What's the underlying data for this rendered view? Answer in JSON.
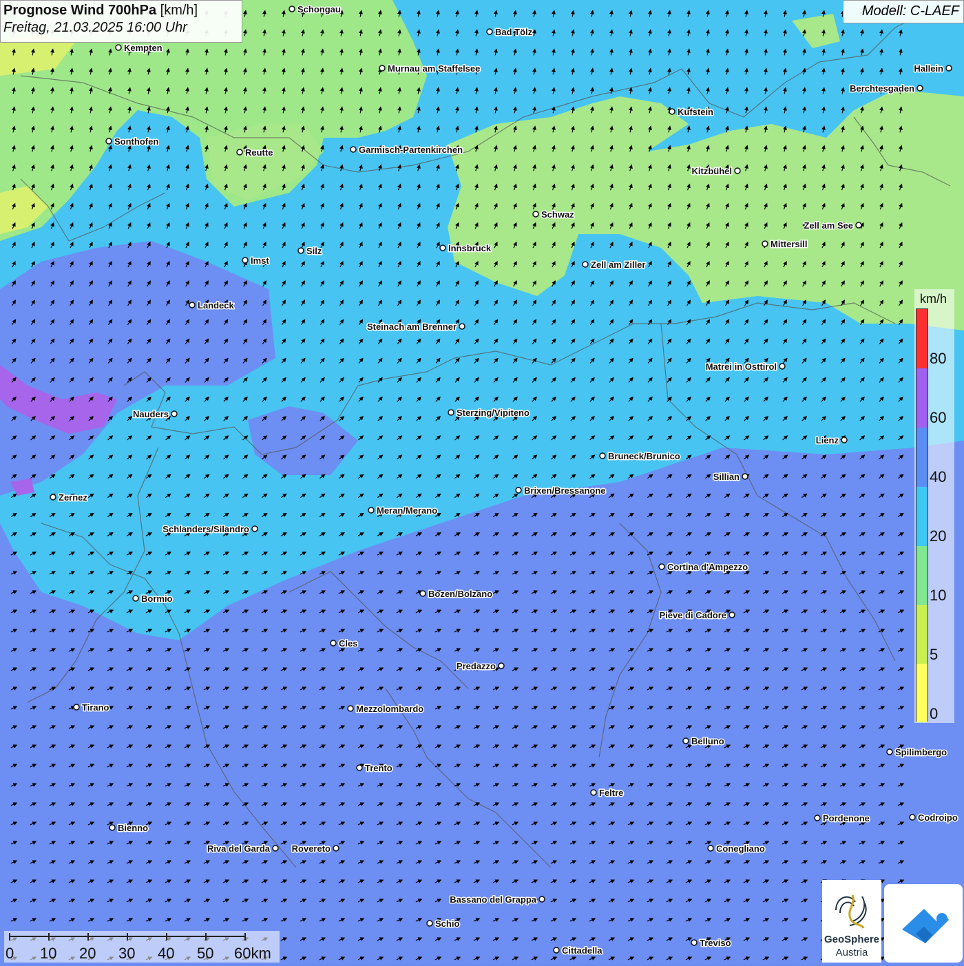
{
  "header": {
    "title_bold": "Prognose Wind 700hPa",
    "title_unit": " [km/h]",
    "subtitle": "Freitag, 21.03.2025 16:00 Uhr"
  },
  "model": "Modell: C-LAEF",
  "legend": {
    "unit": "km/h",
    "items": [
      {
        "value": "80",
        "color": "#ff3030"
      },
      {
        "value": "60",
        "color": "#a060f0"
      },
      {
        "value": "40",
        "color": "#5a8ef5"
      },
      {
        "value": "20",
        "color": "#40c8f5"
      },
      {
        "value": "10",
        "color": "#80e890"
      },
      {
        "value": "5",
        "color": "#c8f050"
      },
      {
        "value": "0",
        "color": "#ffff60"
      }
    ]
  },
  "scale": {
    "ticks": [
      "0",
      "10",
      "20",
      "30",
      "40",
      "50",
      "60km"
    ]
  },
  "cities": [
    {
      "name": "Schongau",
      "label_side": "right"
    },
    {
      "name": "Bad Tölz",
      "label_side": "right"
    },
    {
      "name": "Kempten",
      "label_side": "right"
    },
    {
      "name": "Murnau am Staffelsee",
      "label_side": "right"
    },
    {
      "name": "Hallein",
      "label_side": "left"
    },
    {
      "name": "Berchtesgaden",
      "label_side": "left"
    },
    {
      "name": "Kufstein",
      "label_side": "right"
    },
    {
      "name": "Sonthofen",
      "label_side": "right"
    },
    {
      "name": "Reutte",
      "label_side": "right"
    },
    {
      "name": "Garmisch-Partenkirchen",
      "label_side": "right"
    },
    {
      "name": "Kitzbühel",
      "label_side": "left"
    },
    {
      "name": "Schwaz",
      "label_side": "right"
    },
    {
      "name": "Zell am See",
      "label_side": "left"
    },
    {
      "name": "Mittersill",
      "label_side": "right"
    },
    {
      "name": "Innsbruck",
      "label_side": "right"
    },
    {
      "name": "Silz",
      "label_side": "right"
    },
    {
      "name": "Imst",
      "label_side": "right"
    },
    {
      "name": "Zell am Ziller",
      "label_side": "right"
    },
    {
      "name": "Landeck",
      "label_side": "right"
    },
    {
      "name": "Steinach am Brenner",
      "label_side": "left"
    },
    {
      "name": "Matrei in Osttirol",
      "label_side": "left"
    },
    {
      "name": "Nauders",
      "label_side": "left"
    },
    {
      "name": "Sterzing/Vipiteno",
      "label_side": "right"
    },
    {
      "name": "Lienz",
      "label_side": "left"
    },
    {
      "name": "Bruneck/Brunico",
      "label_side": "right"
    },
    {
      "name": "Sillian",
      "label_side": "left"
    },
    {
      "name": "Zernez",
      "label_side": "right"
    },
    {
      "name": "Brixen/Bressanone",
      "label_side": "right"
    },
    {
      "name": "Meran/Merano",
      "label_side": "right"
    },
    {
      "name": "Schlanders/Silandro",
      "label_side": "left"
    },
    {
      "name": "Cortina d'Ampezzo",
      "label_side": "right"
    },
    {
      "name": "Bozen/Bolzano",
      "label_side": "right"
    },
    {
      "name": "Bormio",
      "label_side": "right"
    },
    {
      "name": "Pieve di Cadore",
      "label_side": "left"
    },
    {
      "name": "Cles",
      "label_side": "right"
    },
    {
      "name": "Predazzo",
      "label_side": "left"
    },
    {
      "name": "Tirano",
      "label_side": "right"
    },
    {
      "name": "Mezzolombardo",
      "label_side": "right"
    },
    {
      "name": "Belluno",
      "label_side": "right"
    },
    {
      "name": "Spilimbergo",
      "label_side": "right"
    },
    {
      "name": "Trento",
      "label_side": "right"
    },
    {
      "name": "Feltre",
      "label_side": "right"
    },
    {
      "name": "Pordenone",
      "label_side": "right"
    },
    {
      "name": "Codroipo",
      "label_side": "right"
    },
    {
      "name": "Bienno",
      "label_side": "right"
    },
    {
      "name": "Riva del Garda",
      "label_side": "left"
    },
    {
      "name": "Rovereto",
      "label_side": "left"
    },
    {
      "name": "Conegliano",
      "label_side": "right"
    },
    {
      "name": "Bassano del Grappa",
      "label_side": "left"
    },
    {
      "name": "Schio",
      "label_side": "right"
    },
    {
      "name": "Treviso",
      "label_side": "right"
    },
    {
      "name": "Cittadella",
      "label_side": "right"
    }
  ],
  "logos": {
    "geosphere_name": "GeoSphere",
    "geosphere_sub": "Austria"
  }
}
